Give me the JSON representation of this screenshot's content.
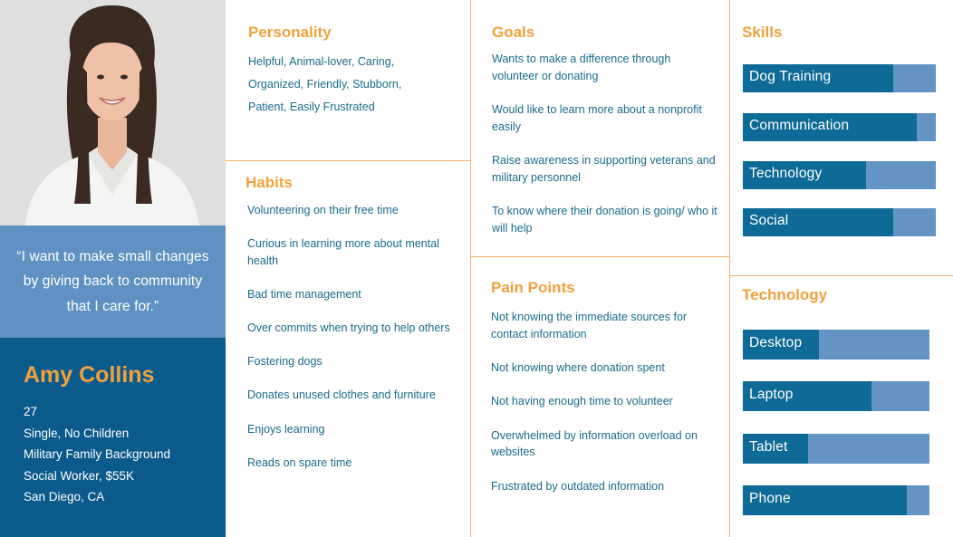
{
  "quote": "“I want to make small changes by giving back to community that I care for.”",
  "profile": {
    "name": "Amy Collins",
    "details": [
      "27",
      "Single, No Children",
      "Military Family Background",
      "Social Worker, $55K",
      "San Diego, CA"
    ]
  },
  "personality": {
    "title": "Personality",
    "lines": [
      "Helpful, Animal-lover, Caring,",
      "Organized, Friendly, Stubborn,",
      "Patient, Easily Frustrated"
    ]
  },
  "habits": {
    "title": "Habits",
    "items": [
      "Volunteering on their free time",
      "Curious in learning more about mental health",
      "Bad time management",
      "Over commits when trying to help others",
      "Fostering dogs",
      "Donates unused clothes and furniture",
      "Enjoys learning",
      "Reads on spare time"
    ]
  },
  "goals": {
    "title": "Goals",
    "items": [
      "Wants to make a difference through volunteer or donating",
      "Would like to learn more about a nonprofit easily",
      "Raise awareness in supporting veterans and military personnel",
      "To know where their donation is going/ who it will help"
    ]
  },
  "pain_points": {
    "title": "Pain Points",
    "items": [
      "Not knowing the immediate sources for contact information",
      "Not knowing where donation spent",
      "Not having enough time to volunteer",
      "Overwhelmed by information overload on websites",
      "Frustrated by outdated information"
    ]
  },
  "skills": {
    "title": "Skills",
    "items": [
      {
        "label": "Dog Training",
        "level": 0.78
      },
      {
        "label": "Communication",
        "level": 0.9
      },
      {
        "label": "Technology",
        "level": 0.64
      },
      {
        "label": "Social",
        "level": 0.78
      }
    ]
  },
  "technology": {
    "title": "Technology",
    "items": [
      {
        "label": "Desktop",
        "level": 0.41
      },
      {
        "label": "Laptop",
        "level": 0.69
      },
      {
        "label": "Tablet",
        "level": 0.35
      },
      {
        "label": "Phone",
        "level": 0.88
      }
    ]
  },
  "colors": {
    "accent_orange": "#f0a13c",
    "text_blue": "#1a6a8c",
    "bar_fill": "#0e6a96",
    "bar_track": "#6394c4",
    "quote_bg": "#5f92c2",
    "profile_bg": "#0b5a8c"
  }
}
